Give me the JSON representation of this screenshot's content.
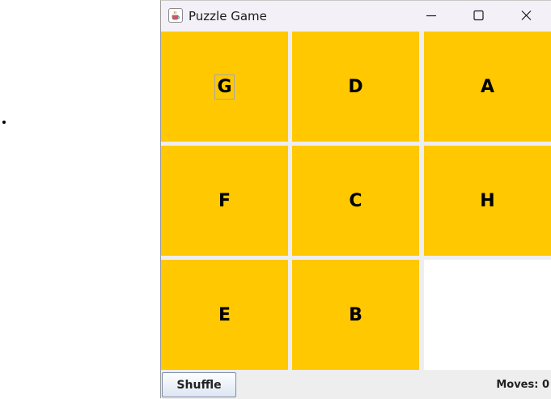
{
  "window": {
    "title": "Puzzle Game",
    "app_icon": "java-coffee-cup-icon",
    "controls": [
      "minimize-icon",
      "maximize-icon",
      "close-icon"
    ]
  },
  "board": {
    "rows": 3,
    "cols": 3,
    "tiles": [
      "G",
      "D",
      "A",
      "F",
      "C",
      "H",
      "E",
      "B",
      ""
    ],
    "tile_color": "#ffc800",
    "empty_color": "#ffffff",
    "focused_tile": "G"
  },
  "bottom": {
    "shuffle_label": "Shuffle",
    "moves_text": "Moves: 0"
  }
}
